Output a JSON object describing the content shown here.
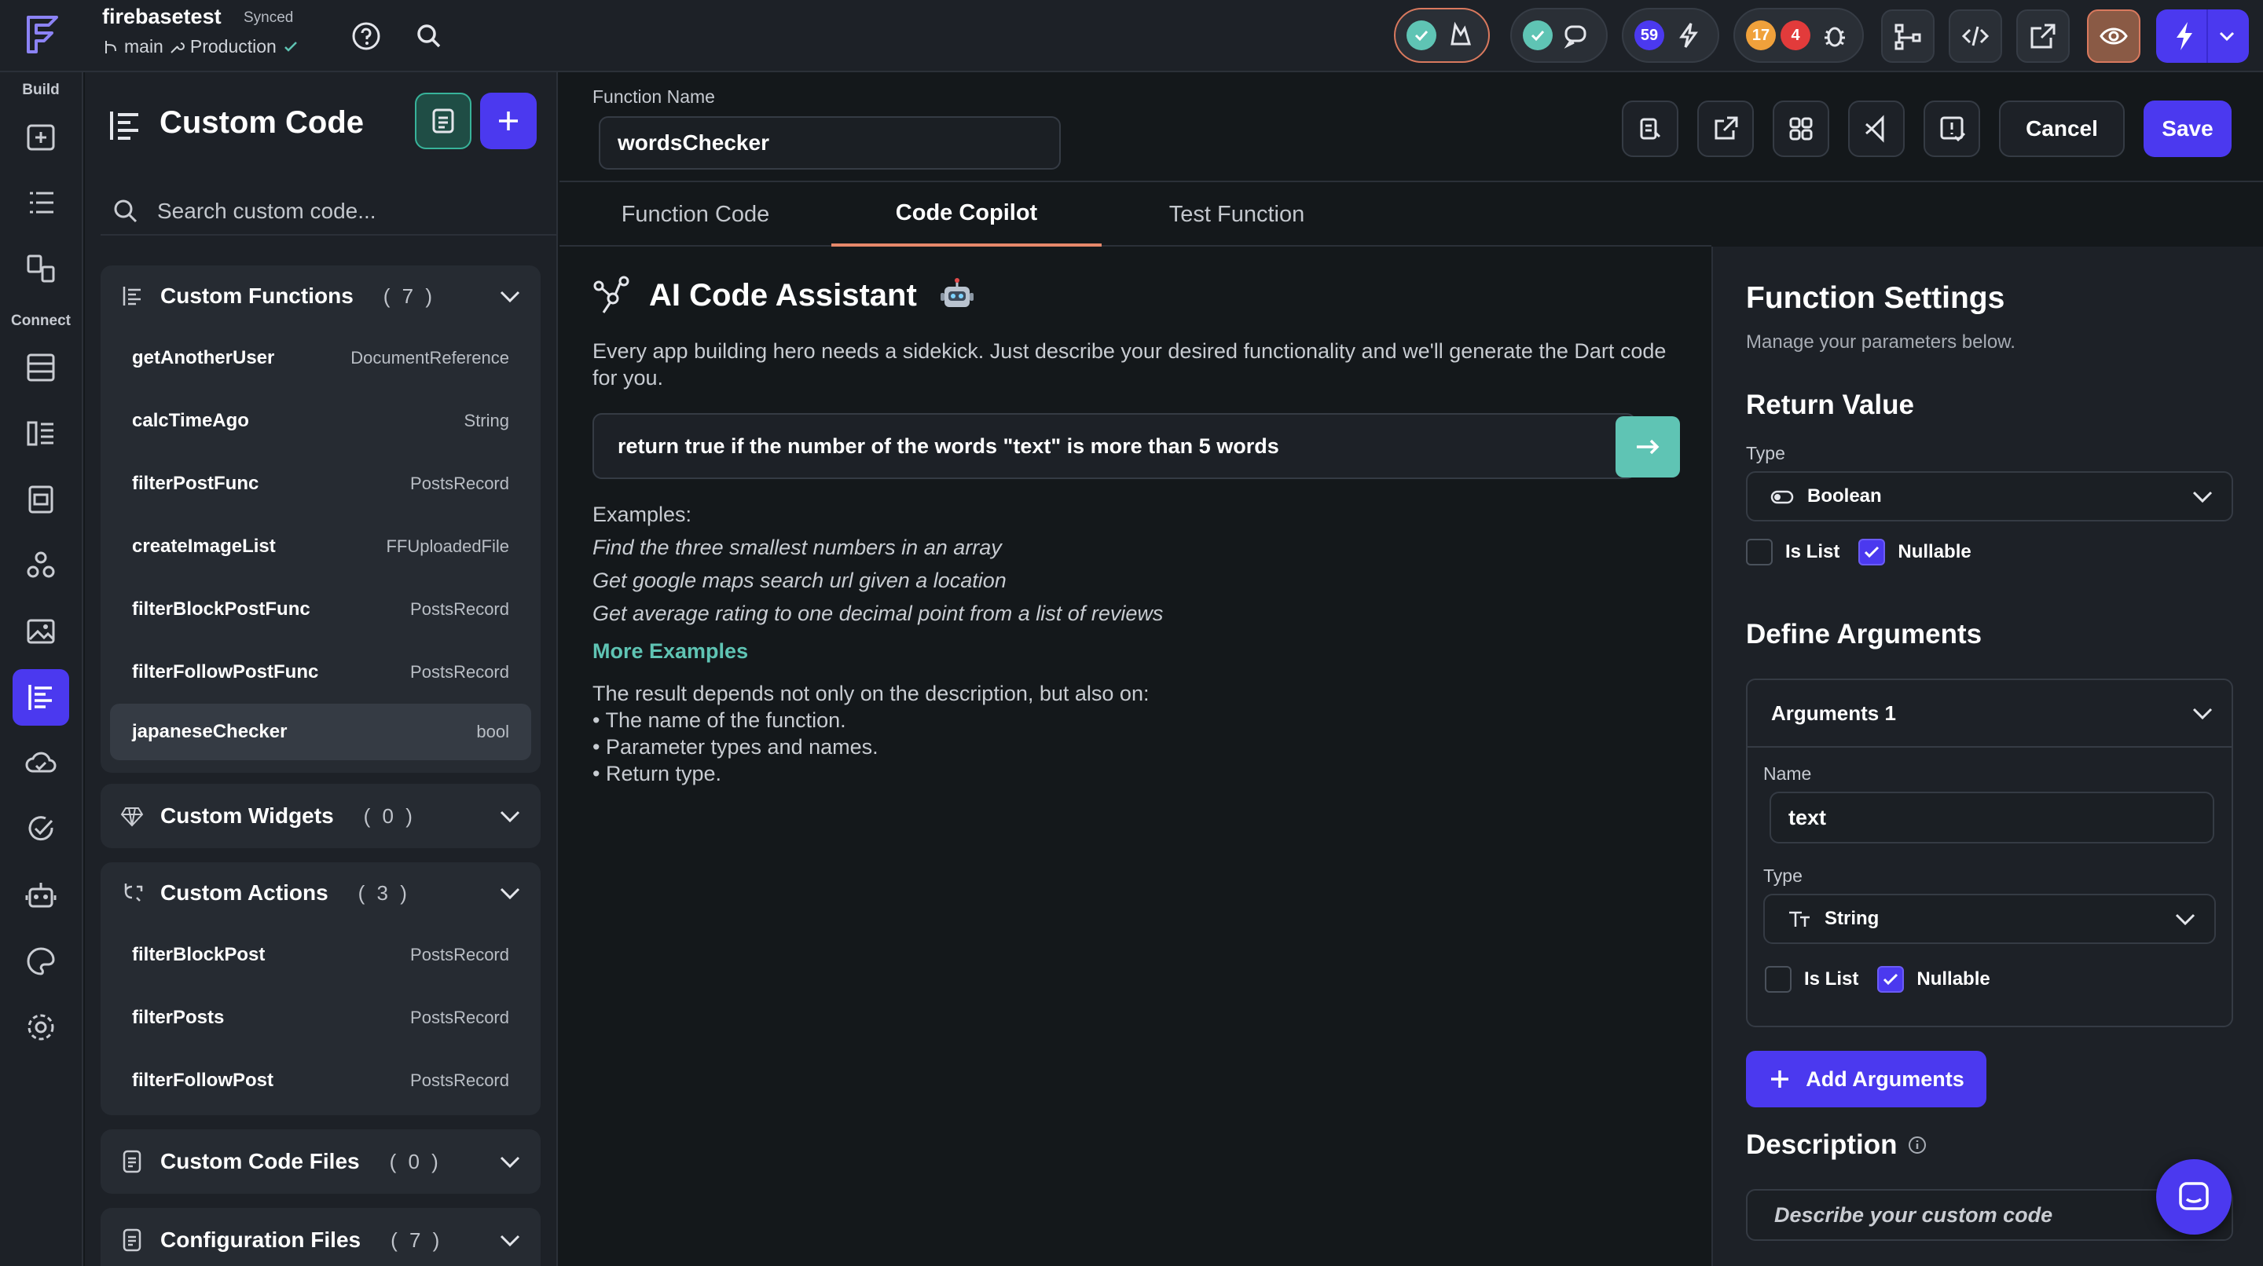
{
  "project": {
    "name": "firebasetest",
    "sync_status": "Synced",
    "branch": "main",
    "environment": "Production"
  },
  "topbar": {
    "issues_count": "59",
    "warnings_count": "17",
    "errors_count": "4"
  },
  "rail": {
    "build_label": "Build",
    "connect_label": "Connect"
  },
  "panel": {
    "title": "Custom Code",
    "search_placeholder": "Search custom code...",
    "custom_functions": {
      "title": "Custom Functions",
      "count": "( 7 )",
      "items": [
        {
          "name": "getAnotherUser",
          "type": "DocumentReference"
        },
        {
          "name": "calcTimeAgo",
          "type": "String"
        },
        {
          "name": "filterPostFunc",
          "type": "PostsRecord"
        },
        {
          "name": "createImageList",
          "type": "FFUploadedFile"
        },
        {
          "name": "filterBlockPostFunc",
          "type": "PostsRecord"
        },
        {
          "name": "filterFollowPostFunc",
          "type": "PostsRecord"
        },
        {
          "name": "japaneseChecker",
          "type": "bool"
        }
      ]
    },
    "custom_widgets": {
      "title": "Custom Widgets",
      "count": "( 0 )"
    },
    "custom_actions": {
      "title": "Custom Actions",
      "count": "( 3 )",
      "items": [
        {
          "name": "filterBlockPost",
          "type": "PostsRecord"
        },
        {
          "name": "filterPosts",
          "type": "PostsRecord"
        },
        {
          "name": "filterFollowPost",
          "type": "PostsRecord"
        }
      ]
    },
    "custom_code_files": {
      "title": "Custom Code Files",
      "count": "( 0 )"
    },
    "configuration_files": {
      "title": "Configuration Files",
      "count": "( 7 )"
    }
  },
  "main": {
    "function_name_label": "Function Name",
    "function_name": "wordsChecker",
    "cancel_label": "Cancel",
    "save_label": "Save",
    "tabs": [
      {
        "label": "Function Code"
      },
      {
        "label": "Code Copilot"
      },
      {
        "label": "Test Function"
      }
    ],
    "assistant": {
      "title": "AI Code Assistant",
      "description": "Every app building hero needs a sidekick. Just describe your desired functionality and we'll generate the Dart code for you.",
      "prompt": "return true if the number of the words \"text\" is more than 5 words",
      "examples_label": "Examples:",
      "examples": [
        "Find the three smallest numbers in an array",
        "Get google maps search url given a location",
        "Get average rating to one decimal point from a list of reviews"
      ],
      "more_examples": "More Examples",
      "note_intro": "The result depends not only on the description, but also on:",
      "note_items": [
        "• The name of the function.",
        "• Parameter types and names.",
        "• Return type."
      ]
    }
  },
  "settings": {
    "title": "Function Settings",
    "subtitle": "Manage your parameters below.",
    "return_value": {
      "title": "Return Value",
      "type_label": "Type",
      "type": "Boolean",
      "is_list_label": "Is List",
      "is_list": false,
      "nullable_label": "Nullable",
      "nullable": true
    },
    "define_arguments": {
      "title": "Define Arguments",
      "arg_title": "Arguments 1",
      "name_label": "Name",
      "name": "text",
      "type_label": "Type",
      "type": "String",
      "is_list_label": "Is List",
      "is_list": false,
      "nullable_label": "Nullable",
      "nullable": true
    },
    "add_arguments_label": "Add Arguments",
    "description_title": "Description",
    "description_placeholder": "Describe your custom code"
  },
  "colors": {
    "accent": "#4b39ef",
    "teal": "#5fc4b4",
    "tab_underline": "#e6886b",
    "background": "#14181b"
  }
}
